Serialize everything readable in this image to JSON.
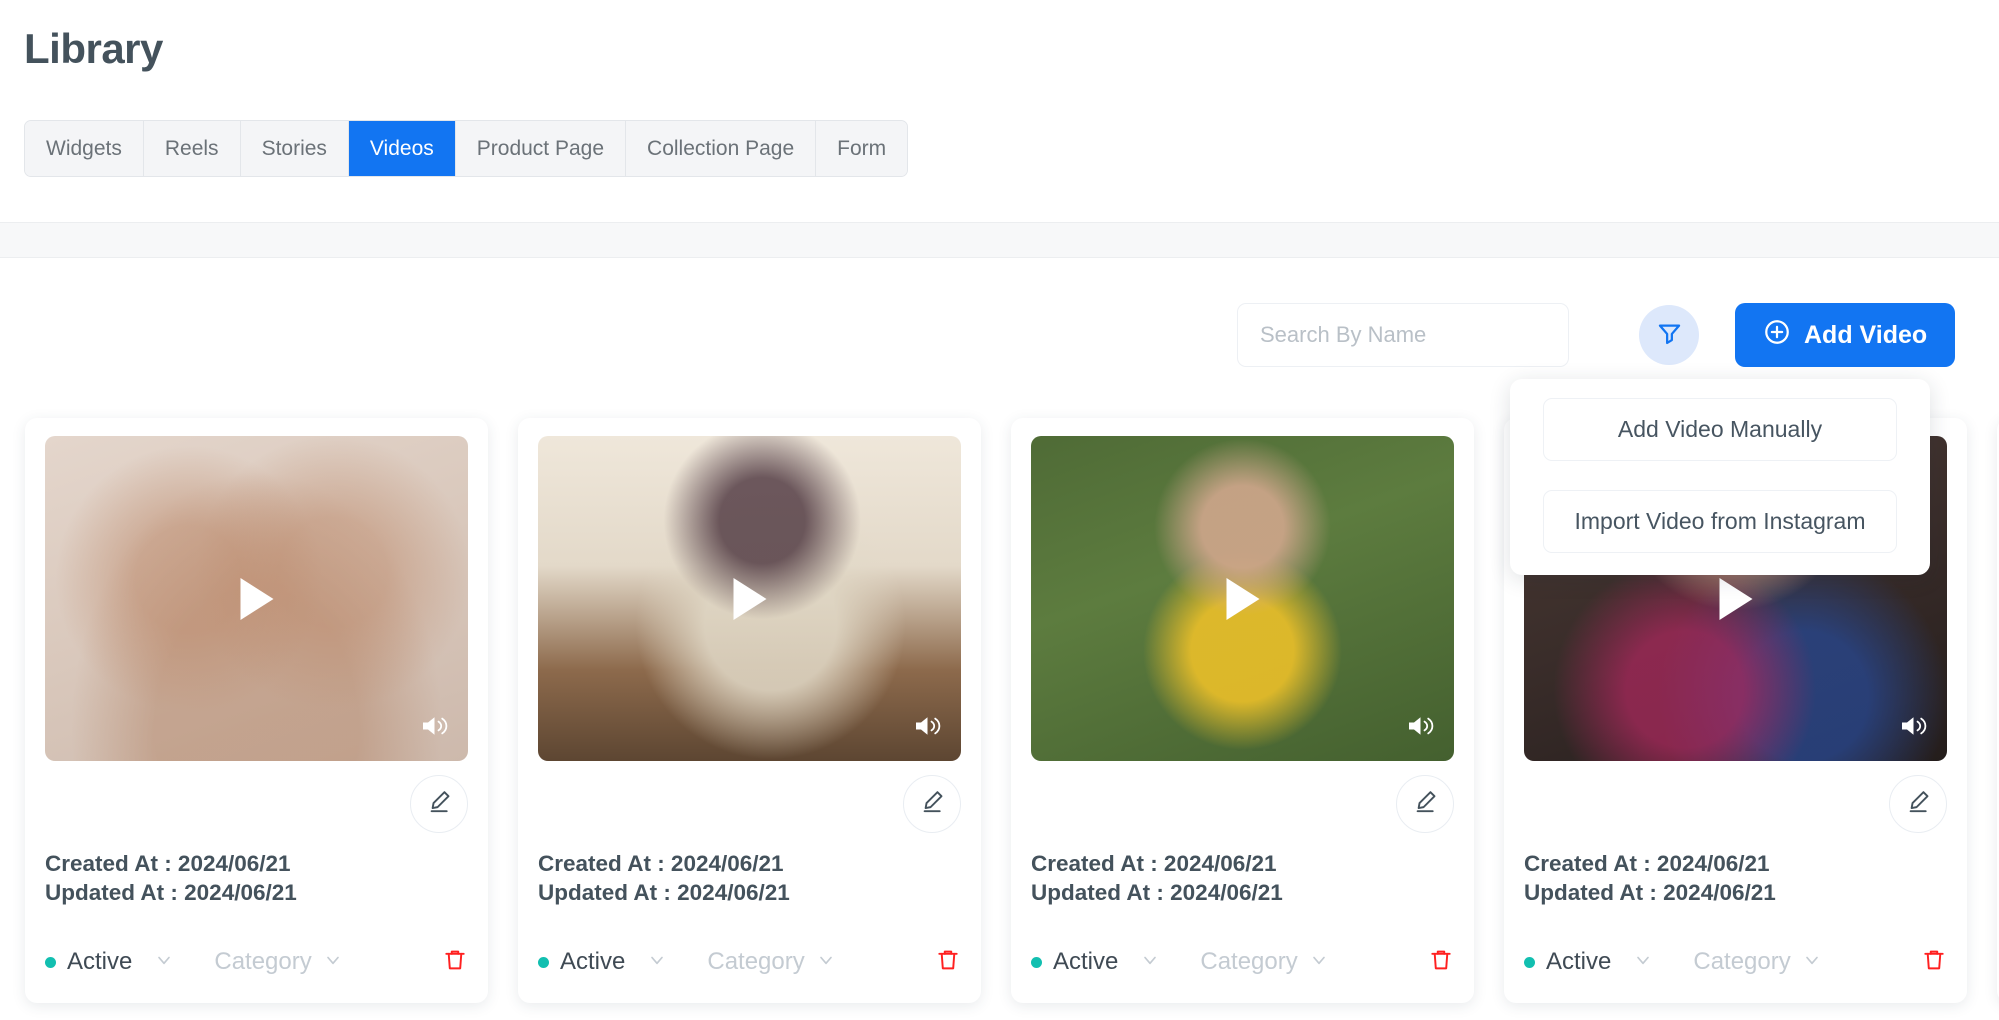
{
  "page": {
    "title": "Library"
  },
  "tabs": [
    {
      "label": "Widgets",
      "active": false
    },
    {
      "label": "Reels",
      "active": false
    },
    {
      "label": "Stories",
      "active": false
    },
    {
      "label": "Videos",
      "active": true
    },
    {
      "label": "Product Page",
      "active": false
    },
    {
      "label": "Collection Page",
      "active": false
    },
    {
      "label": "Form",
      "active": false
    }
  ],
  "toolbar": {
    "search": {
      "value": "",
      "placeholder": "Search By Name",
      "icon": "search-icon"
    },
    "filter": {
      "icon": "filter-funnel-icon"
    },
    "add_video": {
      "label": "Add Video",
      "icon": "plus-circle-icon"
    }
  },
  "dropdown": {
    "items": [
      {
        "label": "Add Video Manually"
      },
      {
        "label": "Import Video from Instagram"
      }
    ]
  },
  "cards": [
    {
      "created_label": "Created At : 2024/06/21",
      "updated_label": "Updated At : 2024/06/21",
      "status": "Active",
      "category": "Category",
      "play_icon": "play-icon",
      "volume_icon": "volume-on-icon",
      "edit_icon": "pencil-edit-icon",
      "delete_icon": "trash-delete-icon"
    },
    {
      "created_label": "Created At : 2024/06/21",
      "updated_label": "Updated At : 2024/06/21",
      "status": "Active",
      "category": "Category",
      "play_icon": "play-icon",
      "volume_icon": "volume-on-icon",
      "edit_icon": "pencil-edit-icon",
      "delete_icon": "trash-delete-icon"
    },
    {
      "created_label": "Created At : 2024/06/21",
      "updated_label": "Updated At : 2024/06/21",
      "status": "Active",
      "category": "Category",
      "play_icon": "play-icon",
      "volume_icon": "volume-on-icon",
      "edit_icon": "pencil-edit-icon",
      "delete_icon": "trash-delete-icon"
    },
    {
      "created_label": "Created At : 2024/06/21",
      "updated_label": "Updated At : 2024/06/21",
      "status": "Active",
      "category": "Category",
      "play_icon": "play-icon",
      "volume_icon": "volume-on-icon",
      "edit_icon": "pencil-edit-icon",
      "delete_icon": "trash-delete-icon"
    }
  ],
  "colors": {
    "accent_blue": "#1275f2",
    "filter_bg": "#dde8fb",
    "title_text": "#44525c",
    "status_dot": "#12bfb0",
    "delete_red": "#ff2020",
    "muted_text": "#c4cbd2"
  }
}
